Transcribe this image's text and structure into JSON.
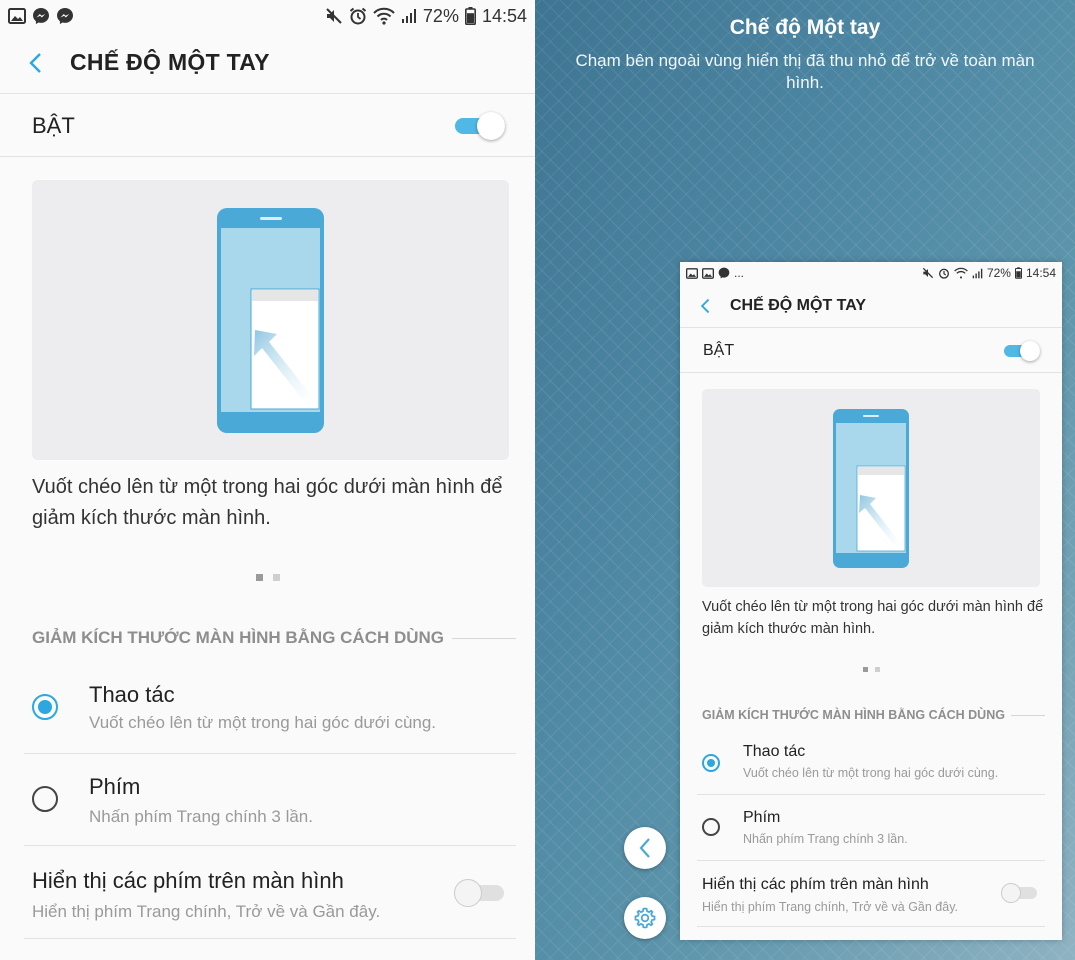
{
  "status_bar": {
    "left_icons": [
      "gallery-icon",
      "messenger-icon",
      "messenger-icon"
    ],
    "right_icons": [
      "mute-icon",
      "alarm-icon",
      "wifi-icon",
      "signal-icon"
    ],
    "battery": "72%",
    "time": "14:54"
  },
  "settings": {
    "title": "CHẾ ĐỘ MỘT TAY",
    "master_label": "BẬT",
    "master_on": true,
    "illustration_caption": "Vuốt chéo lên từ một trong hai góc dưới màn hình để giảm kích thước màn hình.",
    "page_index": 1,
    "page_count": 2,
    "section_header": "GIẢM KÍCH THƯỚC MÀN HÌNH BẰNG CÁCH DÙNG",
    "options": [
      {
        "title": "Thao tác",
        "subtitle": "Vuốt chéo lên từ một trong hai góc dưới cùng.",
        "selected": true
      },
      {
        "title": "Phím",
        "subtitle": "Nhấn phím Trang chính 3 lần.",
        "selected": false
      }
    ],
    "onscreen_keys": {
      "title": "Hiển thị các phím trên màn hình",
      "subtitle": "Hiển thị phím Trang chính, Trở về và Gần đây.",
      "on": false
    }
  },
  "one_hand_overlay": {
    "title": "Chế độ Một tay",
    "subtitle": "Chạm bên ngoài vùng hiển thị đã thu nhỏ để trở về toàn màn hình.",
    "back_button_icon": "chevron-left-icon",
    "settings_button_icon": "gear-icon",
    "mini_status_ellipsis": "..."
  },
  "colors": {
    "accent": "#2da7df",
    "toggle_on": "#4fb8e4",
    "phone_blue": "#4aa9d6",
    "background_teal": "#4d86a2"
  }
}
